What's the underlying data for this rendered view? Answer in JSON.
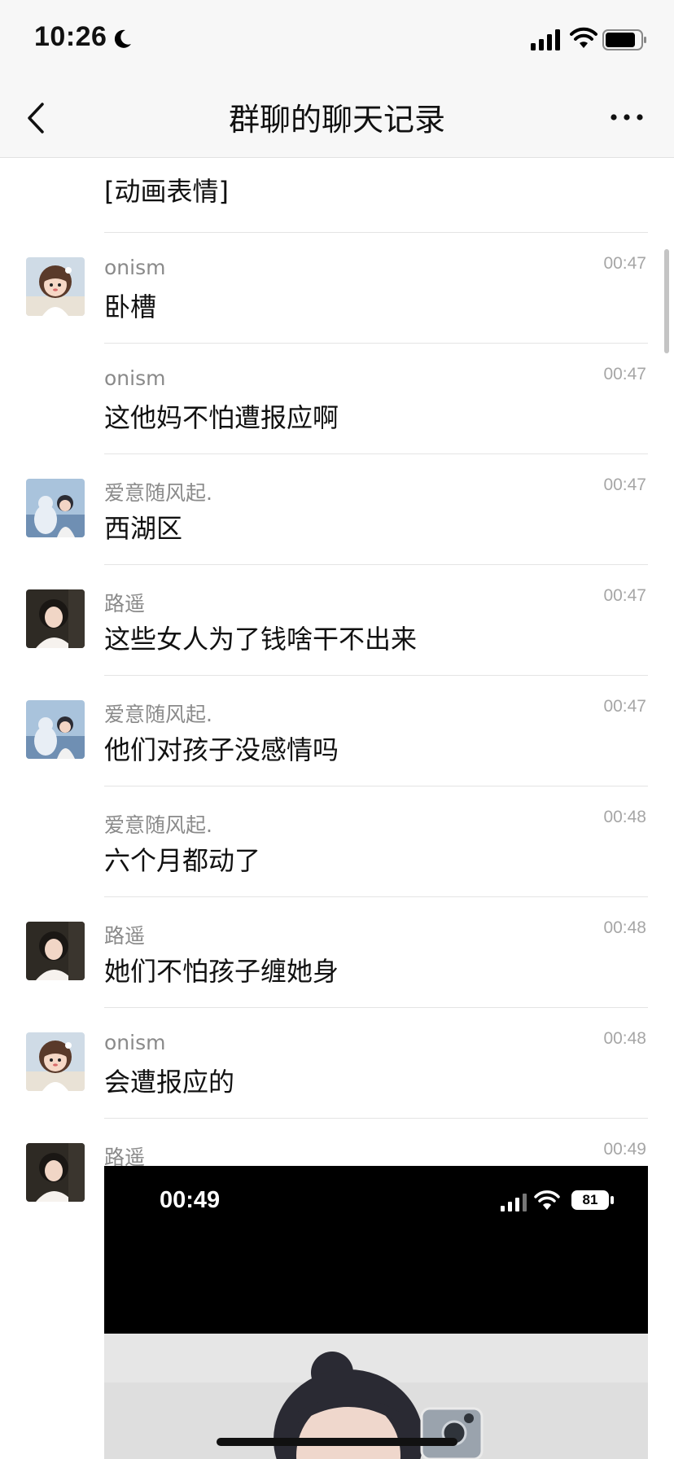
{
  "status_bar": {
    "time": "10:26"
  },
  "nav": {
    "title": "群聊的聊天记录"
  },
  "messages": [
    {
      "sender": "",
      "text": "[动画表情]",
      "time": ""
    },
    {
      "sender": "onism",
      "text": "卧槽",
      "time": "00:47"
    },
    {
      "sender": "onism",
      "text": "这他妈不怕遭报应啊",
      "time": "00:47"
    },
    {
      "sender": "爱意随风起.",
      "text": "西湖区",
      "time": "00:47"
    },
    {
      "sender": "路遥",
      "text": "这些女人为了钱啥干不出来",
      "time": "00:47"
    },
    {
      "sender": "爱意随风起.",
      "text": "他们对孩子没感情吗",
      "time": "00:47"
    },
    {
      "sender": "爱意随风起.",
      "text": "六个月都动了",
      "time": "00:48"
    },
    {
      "sender": "路遥",
      "text": "她们不怕孩子缠她身",
      "time": "00:48"
    },
    {
      "sender": "onism",
      "text": "会遭报应的",
      "time": "00:48"
    },
    {
      "sender": "路遥",
      "text": "",
      "time": "00:49"
    }
  ],
  "image_message": {
    "time": "00:49",
    "battery": "81"
  },
  "colors": {
    "bar_background": "#f7f7f7",
    "divider": "#e4e4e4",
    "sender_gray": "#8a8a8a",
    "time_gray": "#a6a6a6"
  }
}
